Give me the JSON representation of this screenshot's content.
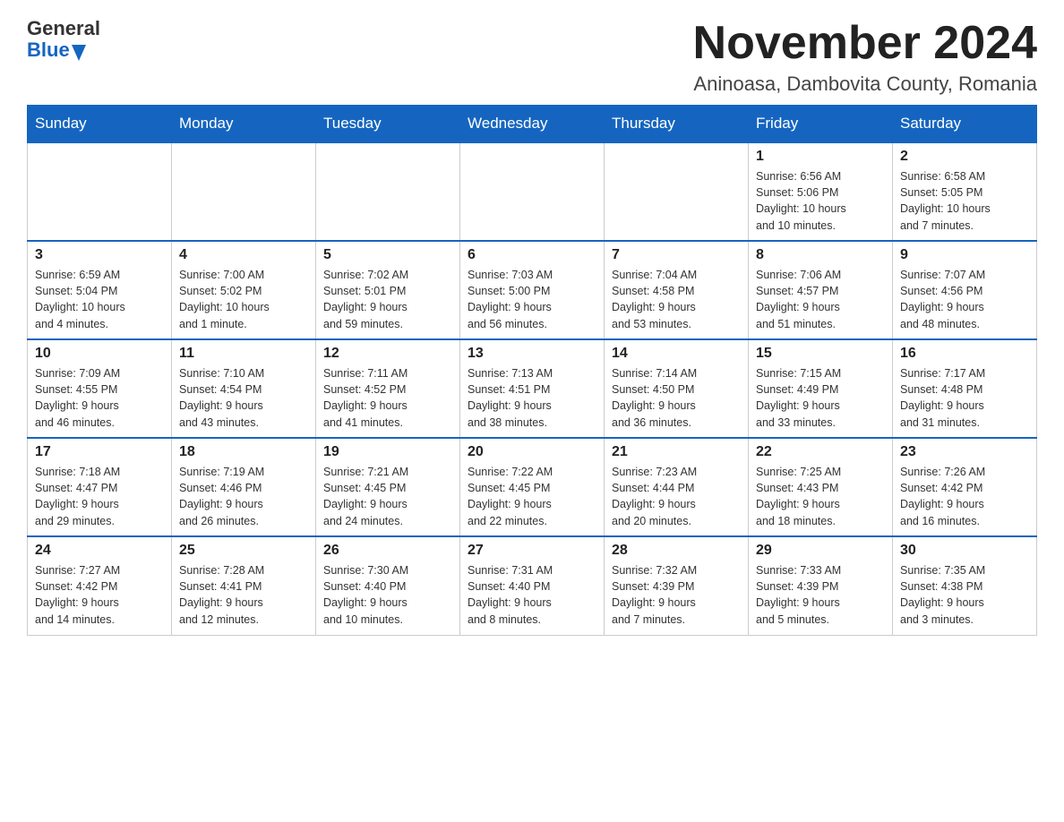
{
  "header": {
    "logo_general": "General",
    "logo_blue": "Blue",
    "month_title": "November 2024",
    "location": "Aninoasa, Dambovita County, Romania"
  },
  "weekdays": [
    "Sunday",
    "Monday",
    "Tuesday",
    "Wednesday",
    "Thursday",
    "Friday",
    "Saturday"
  ],
  "weeks": [
    [
      {
        "day": "",
        "info": ""
      },
      {
        "day": "",
        "info": ""
      },
      {
        "day": "",
        "info": ""
      },
      {
        "day": "",
        "info": ""
      },
      {
        "day": "",
        "info": ""
      },
      {
        "day": "1",
        "info": "Sunrise: 6:56 AM\nSunset: 5:06 PM\nDaylight: 10 hours\nand 10 minutes."
      },
      {
        "day": "2",
        "info": "Sunrise: 6:58 AM\nSunset: 5:05 PM\nDaylight: 10 hours\nand 7 minutes."
      }
    ],
    [
      {
        "day": "3",
        "info": "Sunrise: 6:59 AM\nSunset: 5:04 PM\nDaylight: 10 hours\nand 4 minutes."
      },
      {
        "day": "4",
        "info": "Sunrise: 7:00 AM\nSunset: 5:02 PM\nDaylight: 10 hours\nand 1 minute."
      },
      {
        "day": "5",
        "info": "Sunrise: 7:02 AM\nSunset: 5:01 PM\nDaylight: 9 hours\nand 59 minutes."
      },
      {
        "day": "6",
        "info": "Sunrise: 7:03 AM\nSunset: 5:00 PM\nDaylight: 9 hours\nand 56 minutes."
      },
      {
        "day": "7",
        "info": "Sunrise: 7:04 AM\nSunset: 4:58 PM\nDaylight: 9 hours\nand 53 minutes."
      },
      {
        "day": "8",
        "info": "Sunrise: 7:06 AM\nSunset: 4:57 PM\nDaylight: 9 hours\nand 51 minutes."
      },
      {
        "day": "9",
        "info": "Sunrise: 7:07 AM\nSunset: 4:56 PM\nDaylight: 9 hours\nand 48 minutes."
      }
    ],
    [
      {
        "day": "10",
        "info": "Sunrise: 7:09 AM\nSunset: 4:55 PM\nDaylight: 9 hours\nand 46 minutes."
      },
      {
        "day": "11",
        "info": "Sunrise: 7:10 AM\nSunset: 4:54 PM\nDaylight: 9 hours\nand 43 minutes."
      },
      {
        "day": "12",
        "info": "Sunrise: 7:11 AM\nSunset: 4:52 PM\nDaylight: 9 hours\nand 41 minutes."
      },
      {
        "day": "13",
        "info": "Sunrise: 7:13 AM\nSunset: 4:51 PM\nDaylight: 9 hours\nand 38 minutes."
      },
      {
        "day": "14",
        "info": "Sunrise: 7:14 AM\nSunset: 4:50 PM\nDaylight: 9 hours\nand 36 minutes."
      },
      {
        "day": "15",
        "info": "Sunrise: 7:15 AM\nSunset: 4:49 PM\nDaylight: 9 hours\nand 33 minutes."
      },
      {
        "day": "16",
        "info": "Sunrise: 7:17 AM\nSunset: 4:48 PM\nDaylight: 9 hours\nand 31 minutes."
      }
    ],
    [
      {
        "day": "17",
        "info": "Sunrise: 7:18 AM\nSunset: 4:47 PM\nDaylight: 9 hours\nand 29 minutes."
      },
      {
        "day": "18",
        "info": "Sunrise: 7:19 AM\nSunset: 4:46 PM\nDaylight: 9 hours\nand 26 minutes."
      },
      {
        "day": "19",
        "info": "Sunrise: 7:21 AM\nSunset: 4:45 PM\nDaylight: 9 hours\nand 24 minutes."
      },
      {
        "day": "20",
        "info": "Sunrise: 7:22 AM\nSunset: 4:45 PM\nDaylight: 9 hours\nand 22 minutes."
      },
      {
        "day": "21",
        "info": "Sunrise: 7:23 AM\nSunset: 4:44 PM\nDaylight: 9 hours\nand 20 minutes."
      },
      {
        "day": "22",
        "info": "Sunrise: 7:25 AM\nSunset: 4:43 PM\nDaylight: 9 hours\nand 18 minutes."
      },
      {
        "day": "23",
        "info": "Sunrise: 7:26 AM\nSunset: 4:42 PM\nDaylight: 9 hours\nand 16 minutes."
      }
    ],
    [
      {
        "day": "24",
        "info": "Sunrise: 7:27 AM\nSunset: 4:42 PM\nDaylight: 9 hours\nand 14 minutes."
      },
      {
        "day": "25",
        "info": "Sunrise: 7:28 AM\nSunset: 4:41 PM\nDaylight: 9 hours\nand 12 minutes."
      },
      {
        "day": "26",
        "info": "Sunrise: 7:30 AM\nSunset: 4:40 PM\nDaylight: 9 hours\nand 10 minutes."
      },
      {
        "day": "27",
        "info": "Sunrise: 7:31 AM\nSunset: 4:40 PM\nDaylight: 9 hours\nand 8 minutes."
      },
      {
        "day": "28",
        "info": "Sunrise: 7:32 AM\nSunset: 4:39 PM\nDaylight: 9 hours\nand 7 minutes."
      },
      {
        "day": "29",
        "info": "Sunrise: 7:33 AM\nSunset: 4:39 PM\nDaylight: 9 hours\nand 5 minutes."
      },
      {
        "day": "30",
        "info": "Sunrise: 7:35 AM\nSunset: 4:38 PM\nDaylight: 9 hours\nand 3 minutes."
      }
    ]
  ]
}
